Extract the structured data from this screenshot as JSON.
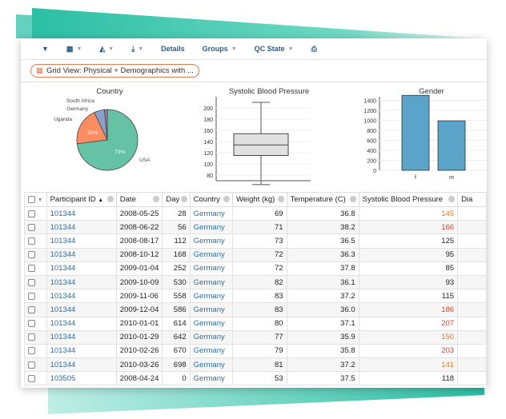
{
  "toolbar": {
    "details": "Details",
    "groups": "Groups",
    "qc_state": "QC State"
  },
  "view_button": "Grid View: Physical + Demographics with ...",
  "colors": {
    "link": "#2a6ea6",
    "high": "#d9432b",
    "elevated": "#e07b2a",
    "pie_usa": "#66c2a5",
    "pie_uganda": "#fc8d62",
    "pie_germany": "#8da0cb",
    "pie_sa": "#a07cb0",
    "bar": "#5ba3c9"
  },
  "charts": {
    "country": {
      "title": "Country",
      "slices": [
        {
          "label": "USA",
          "value": 73,
          "pct_label": "73%"
        },
        {
          "label": "Uganda",
          "value": 20,
          "pct_label": "20%"
        },
        {
          "label": "Germany",
          "value": 5.5,
          "pct_label": ""
        },
        {
          "label": "South Africa",
          "value": 1.5,
          "pct_label": ""
        }
      ]
    },
    "sbp": {
      "title": "Systolic Blood Pressure",
      "ticks": [
        "200",
        "180",
        "160",
        "140",
        "120",
        "100",
        "80"
      ],
      "min": 63,
      "q1": 115,
      "median": 134,
      "q3": 154,
      "max": 210
    },
    "gender": {
      "title": "Gender",
      "ticks": [
        "1400",
        "1200",
        "1000",
        "800",
        "600",
        "400",
        "200",
        "0"
      ],
      "bars": [
        {
          "label": "f",
          "value": 1500
        },
        {
          "label": "m",
          "value": 990
        }
      ]
    }
  },
  "table": {
    "headers": [
      "Participant ID",
      "Date",
      "Day",
      "Country",
      "Weight (kg)",
      "Temperature (C)",
      "Systolic Blood Pressure",
      "Dia"
    ],
    "rows": [
      [
        "101344",
        "2008-05-25",
        "28",
        "Germany",
        "69",
        "36.8",
        "145"
      ],
      [
        "101344",
        "2008-06-22",
        "56",
        "Germany",
        "71",
        "38.2",
        "166"
      ],
      [
        "101344",
        "2008-08-17",
        "112",
        "Germany",
        "73",
        "36.5",
        "125"
      ],
      [
        "101344",
        "2008-10-12",
        "168",
        "Germany",
        "72",
        "36.3",
        "95"
      ],
      [
        "101344",
        "2009-01-04",
        "252",
        "Germany",
        "72",
        "37.8",
        "85"
      ],
      [
        "101344",
        "2009-10-09",
        "530",
        "Germany",
        "82",
        "36.1",
        "93"
      ],
      [
        "101344",
        "2009-11-06",
        "558",
        "Germany",
        "83",
        "37.2",
        "115"
      ],
      [
        "101344",
        "2009-12-04",
        "586",
        "Germany",
        "83",
        "36.0",
        "186"
      ],
      [
        "101344",
        "2010-01-01",
        "614",
        "Germany",
        "80",
        "37.1",
        "207"
      ],
      [
        "101344",
        "2010-01-29",
        "642",
        "Germany",
        "77",
        "35.9",
        "150"
      ],
      [
        "101344",
        "2010-02-26",
        "670",
        "Germany",
        "79",
        "35.8",
        "203"
      ],
      [
        "101344",
        "2010-03-26",
        "698",
        "Germany",
        "81",
        "37.2",
        "141"
      ],
      [
        "103505",
        "2008-04-24",
        "0",
        "Germany",
        "53",
        "37.5",
        "118"
      ]
    ]
  }
}
